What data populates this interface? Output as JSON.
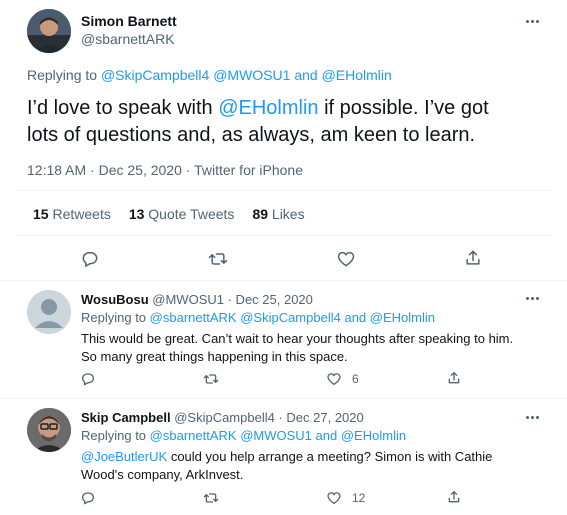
{
  "main_tweet": {
    "author_name": "Simon Barnett",
    "author_handle": "@sbarnettARK",
    "replying_to_prefix": "Replying to",
    "replying_to_1": "@SkipCampbell4",
    "replying_to_2": "@MWOSU1",
    "replying_to_and": "and",
    "replying_to_3": "@EHolmlin",
    "text_part1": "I’d love to speak with",
    "text_mention": "@EHolmlin",
    "text_part2": "if possible. I’ve got",
    "text_line2": "lots of questions and, as always, am keen to learn.",
    "timestamp": "12:18 AM · Dec 25, 2020 · Twitter for iPhone",
    "retweets_count": "15",
    "retweets_label": "Retweets",
    "quotes_count": "13",
    "quotes_label": "Quote Tweets",
    "likes_count": "89",
    "likes_label": "Likes"
  },
  "replies": [
    {
      "author_name": "WosuBosu",
      "author_handle": "@MWOSU1",
      "date": "· Dec 25, 2020",
      "replying_to_prefix": "Replying to",
      "replying_to_1": "@sbarnettARK",
      "replying_to_2": "@SkipCampbell4",
      "replying_to_and": "and",
      "replying_to_3": "@EHolmlin",
      "text_line1": "This would be great. Can’t wait to hear your thoughts after speaking to him.",
      "text_line2": "So many great things happening in this space.",
      "like_count": "6"
    },
    {
      "author_name": "Skip Campbell",
      "author_handle": "@SkipCampbell4",
      "date": "· Dec 27, 2020",
      "replying_to_prefix": "Replying to",
      "replying_to_1": "@sbarnettARK",
      "replying_to_2": "@MWOSU1",
      "replying_to_and": "and",
      "replying_to_3": "@EHolmlin",
      "text_mention": "@JoeButlerUK",
      "text_line1": "could you help arrange a meeting? Simon is with Cathie",
      "text_line2": "Wood's company, ArkInvest.",
      "like_count": "12"
    }
  ],
  "icons": [
    "reply-icon",
    "retweet-icon",
    "like-icon",
    "share-icon",
    "more-icon"
  ],
  "colors": {
    "link": "#1d9bf0",
    "muted": "#536471",
    "text": "#0f1419",
    "divider": "#eff3f4"
  }
}
